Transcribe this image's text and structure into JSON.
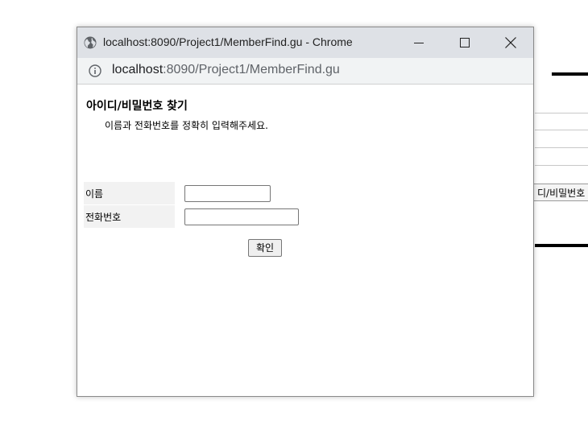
{
  "background": {
    "button_text": "디/비밀번호"
  },
  "window": {
    "title": "localhost:8090/Project1/MemberFind.gu - Chrome",
    "url_host": "localhost",
    "url_rest": ":8090/Project1/MemberFind.gu"
  },
  "page": {
    "heading": "아이디/비밀번호 찾기",
    "description": "이름과 전화번호를 정확히 입력해주세요.",
    "form": {
      "name_label": "이름",
      "name_value": "",
      "phone_label": "전화번호",
      "phone_value": ""
    },
    "confirm_label": "확인"
  }
}
